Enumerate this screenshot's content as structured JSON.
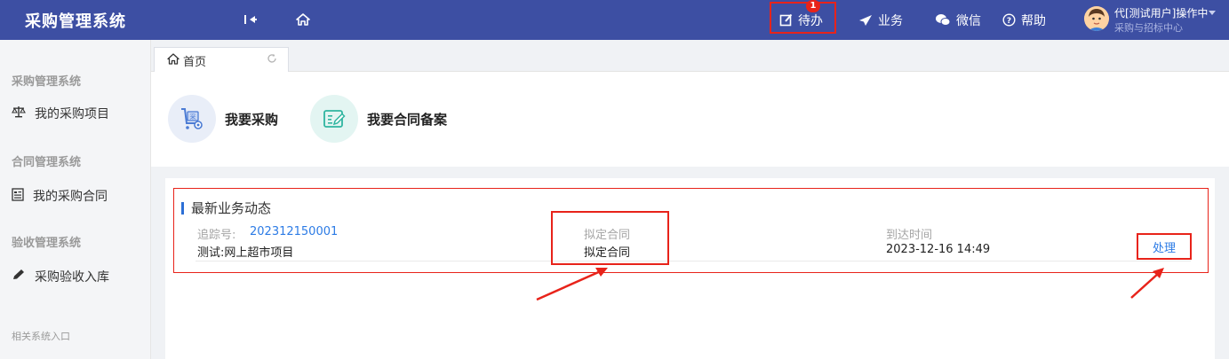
{
  "header": {
    "app_title": "采购管理系统",
    "nav": [
      {
        "label": "待办",
        "icon": "edit-icon",
        "badge": "1"
      },
      {
        "label": "业务",
        "icon": "send-icon"
      },
      {
        "label": "微信",
        "icon": "wechat-icon"
      },
      {
        "label": "帮助",
        "icon": "help-icon"
      }
    ],
    "user": {
      "name": "代[测试用户]操作中",
      "dept": "采购与招标中心"
    }
  },
  "sidebar": {
    "groups": [
      {
        "title": "采购管理系统",
        "item": {
          "label": "我的采购项目",
          "icon": "scale-icon"
        }
      },
      {
        "title": "合同管理系统",
        "item": {
          "label": "我的采购合同",
          "icon": "document-icon"
        }
      },
      {
        "title": "验收管理系统",
        "item": {
          "label": "采购验收入库",
          "icon": "pencil-icon"
        }
      }
    ],
    "footer": "相关系统入口"
  },
  "tabs": [
    {
      "label": "首页",
      "icon": "home-icon"
    }
  ],
  "quick_actions": [
    {
      "label": "我要采购",
      "icon": "cart-icon"
    },
    {
      "label": "我要合同备案",
      "icon": "contract-edit-icon"
    }
  ],
  "dynamics": {
    "title": "最新业务动态",
    "rows": [
      {
        "track_label": "追踪号:",
        "track_no": "202312150001",
        "project": "测试:网上超市项目",
        "stage_label": "拟定合同",
        "stage_value": "拟定合同",
        "time_label": "到达时间",
        "time_value": "2023-12-16 14:49",
        "action": "处理"
      }
    ]
  },
  "colors": {
    "header_bg": "#3d4fa3",
    "highlight": "#e8231a",
    "link": "#2c7be5"
  }
}
